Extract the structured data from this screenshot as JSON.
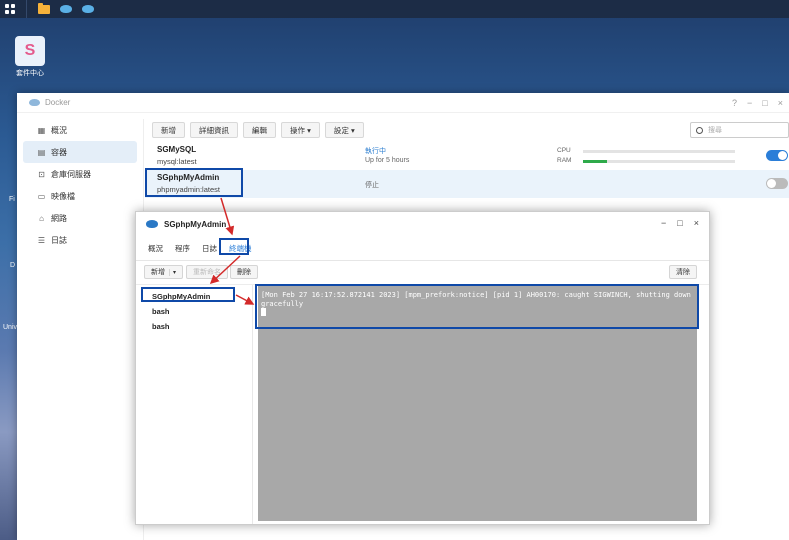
{
  "taskbar": {
    "apps_icon": "grid-icon",
    "items": [
      "folder-icon",
      "docker-icon",
      "docker-icon"
    ]
  },
  "desktop": {
    "package_center_label": "套件中心",
    "package_center_glyph": "S",
    "fragments": [
      "Fi",
      "D",
      "Univ"
    ]
  },
  "docker_window": {
    "title": "Docker",
    "controls": {
      "help": "?",
      "minimize": "−",
      "maximize": "□",
      "close": "×"
    },
    "sidebar": [
      {
        "label": "概況",
        "icon": "overview-icon",
        "glyph": "▦"
      },
      {
        "label": "容器",
        "icon": "container-icon",
        "glyph": "▤"
      },
      {
        "label": "倉庫伺服器",
        "icon": "registry-icon",
        "glyph": "⊡"
      },
      {
        "label": "映像檔",
        "icon": "image-icon",
        "glyph": "▭"
      },
      {
        "label": "網路",
        "icon": "network-icon",
        "glyph": "⌂"
      },
      {
        "label": "日誌",
        "icon": "log-icon",
        "glyph": "☰"
      }
    ],
    "toolbar": {
      "create": "新增",
      "details": "詳細資訊",
      "edit": "編輯",
      "action": "操作 ▾",
      "settings": "設定 ▾"
    },
    "search_placeholder": "搜尋",
    "containers": [
      {
        "name": "SGMySQL",
        "image": "mysql:latest",
        "status": "執行中",
        "uptime": "Up for 5 hours",
        "cpu_label": "CPU",
        "ram_label": "RAM",
        "cpu_pct": 0,
        "ram_pct": 16,
        "enabled": true
      },
      {
        "name": "SGphpMyAdmin",
        "image": "phpmyadmin:latest",
        "status": "停止",
        "enabled": false
      }
    ]
  },
  "detail_window": {
    "title": "SGphpMyAdmin",
    "controls": {
      "minimize": "−",
      "maximize": "□",
      "close": "×"
    },
    "tabs": [
      "概況",
      "程序",
      "日誌",
      "終端機"
    ],
    "active_tab": "終端機",
    "toolbar": {
      "create": "新增",
      "dropdown": "▾",
      "rename": "重新命名",
      "delete": "刪除",
      "clear": "清除"
    },
    "sessions": [
      "SGphpMyAdmin",
      "bash",
      "bash"
    ],
    "terminal_output": "[Mon Feb 27 16:17:52.872141 2023] [mpm_prefork:notice] [pid 1] AH00170: caught SIGWINCH, shutting down gracefully"
  },
  "annotation_color": "#0f49a8",
  "arrow_color": "#d32a2a"
}
